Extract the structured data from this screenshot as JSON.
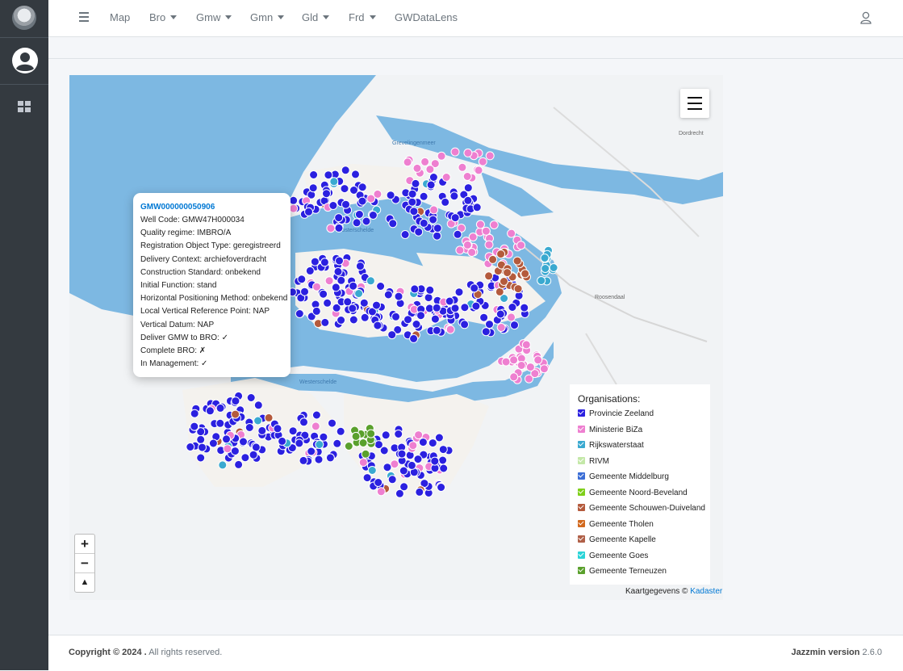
{
  "sidebar": {
    "logo_icon": "site-logo-icon",
    "user_icon": "user-circle-icon",
    "dashboard_icon": "th-large-icon"
  },
  "nav": {
    "menu_icon": "bars-icon",
    "items": [
      {
        "label": "Map",
        "dropdown": false
      },
      {
        "label": "Bro",
        "dropdown": true
      },
      {
        "label": "Gmw",
        "dropdown": true
      },
      {
        "label": "Gmn",
        "dropdown": true
      },
      {
        "label": "Gld",
        "dropdown": true
      },
      {
        "label": "Frd",
        "dropdown": true
      },
      {
        "label": "GWDataLens",
        "dropdown": false
      }
    ],
    "user_icon": "user-outline-icon"
  },
  "map": {
    "labels": {
      "oosterschelde": "Oosterschelde",
      "westerschelde": "Westerschelde",
      "haringvliet": "Grevelingenmeer",
      "dordrecht": "Dordrecht",
      "roosendaal": "Roosendaal"
    },
    "popup": {
      "title": "GMW000000050906",
      "lines": [
        "Well Code: GMW47H000034",
        "Quality regime: IMBRO/A",
        "Registration Object Type: geregistreerd",
        "Delivery Context: archiefoverdracht",
        "Construction Standard: onbekend",
        "Initial Function: stand",
        "Horizontal Positioning Method: onbekend",
        "Local Vertical Reference Point: NAP",
        "Vertical Datum: NAP",
        "Deliver GMW to BRO: ✓",
        "Complete BRO: ✗",
        "In Management: ✓"
      ]
    },
    "zoom": {
      "in": "+",
      "out": "−",
      "reset": "▲"
    },
    "legend": {
      "title": "Organisations:",
      "items": [
        {
          "label": "Provincie Zeeland",
          "color": "#2b20e0"
        },
        {
          "label": "Ministerie BiZa",
          "color": "#ee7fd0"
        },
        {
          "label": "Rijkswaterstaat",
          "color": "#3aa9d0"
        },
        {
          "label": "RIVM",
          "color": "#c4e8a8"
        },
        {
          "label": "Gemeente Middelburg",
          "color": "#3c6ed6"
        },
        {
          "label": "Gemeente Noord-Beveland",
          "color": "#7fcf1a"
        },
        {
          "label": "Gemeente Schouwen-Duiveland",
          "color": "#b45a3c"
        },
        {
          "label": "Gemeente Tholen",
          "color": "#d2691e"
        },
        {
          "label": "Gemeente Kapelle",
          "color": "#b06048"
        },
        {
          "label": "Gemeente Goes",
          "color": "#2ad4d8"
        },
        {
          "label": "Gemeente Terneuzen",
          "color": "#5aa02c"
        }
      ]
    },
    "attribution": {
      "text": "Kaartgegevens ©",
      "link": "Kadaster"
    }
  },
  "footer": {
    "copyright_bold": "Copyright © 2024 .",
    "copyright_rest": " All rights reserved.",
    "version_bold": "Jazzmin version",
    "version": " 2.6.0"
  }
}
